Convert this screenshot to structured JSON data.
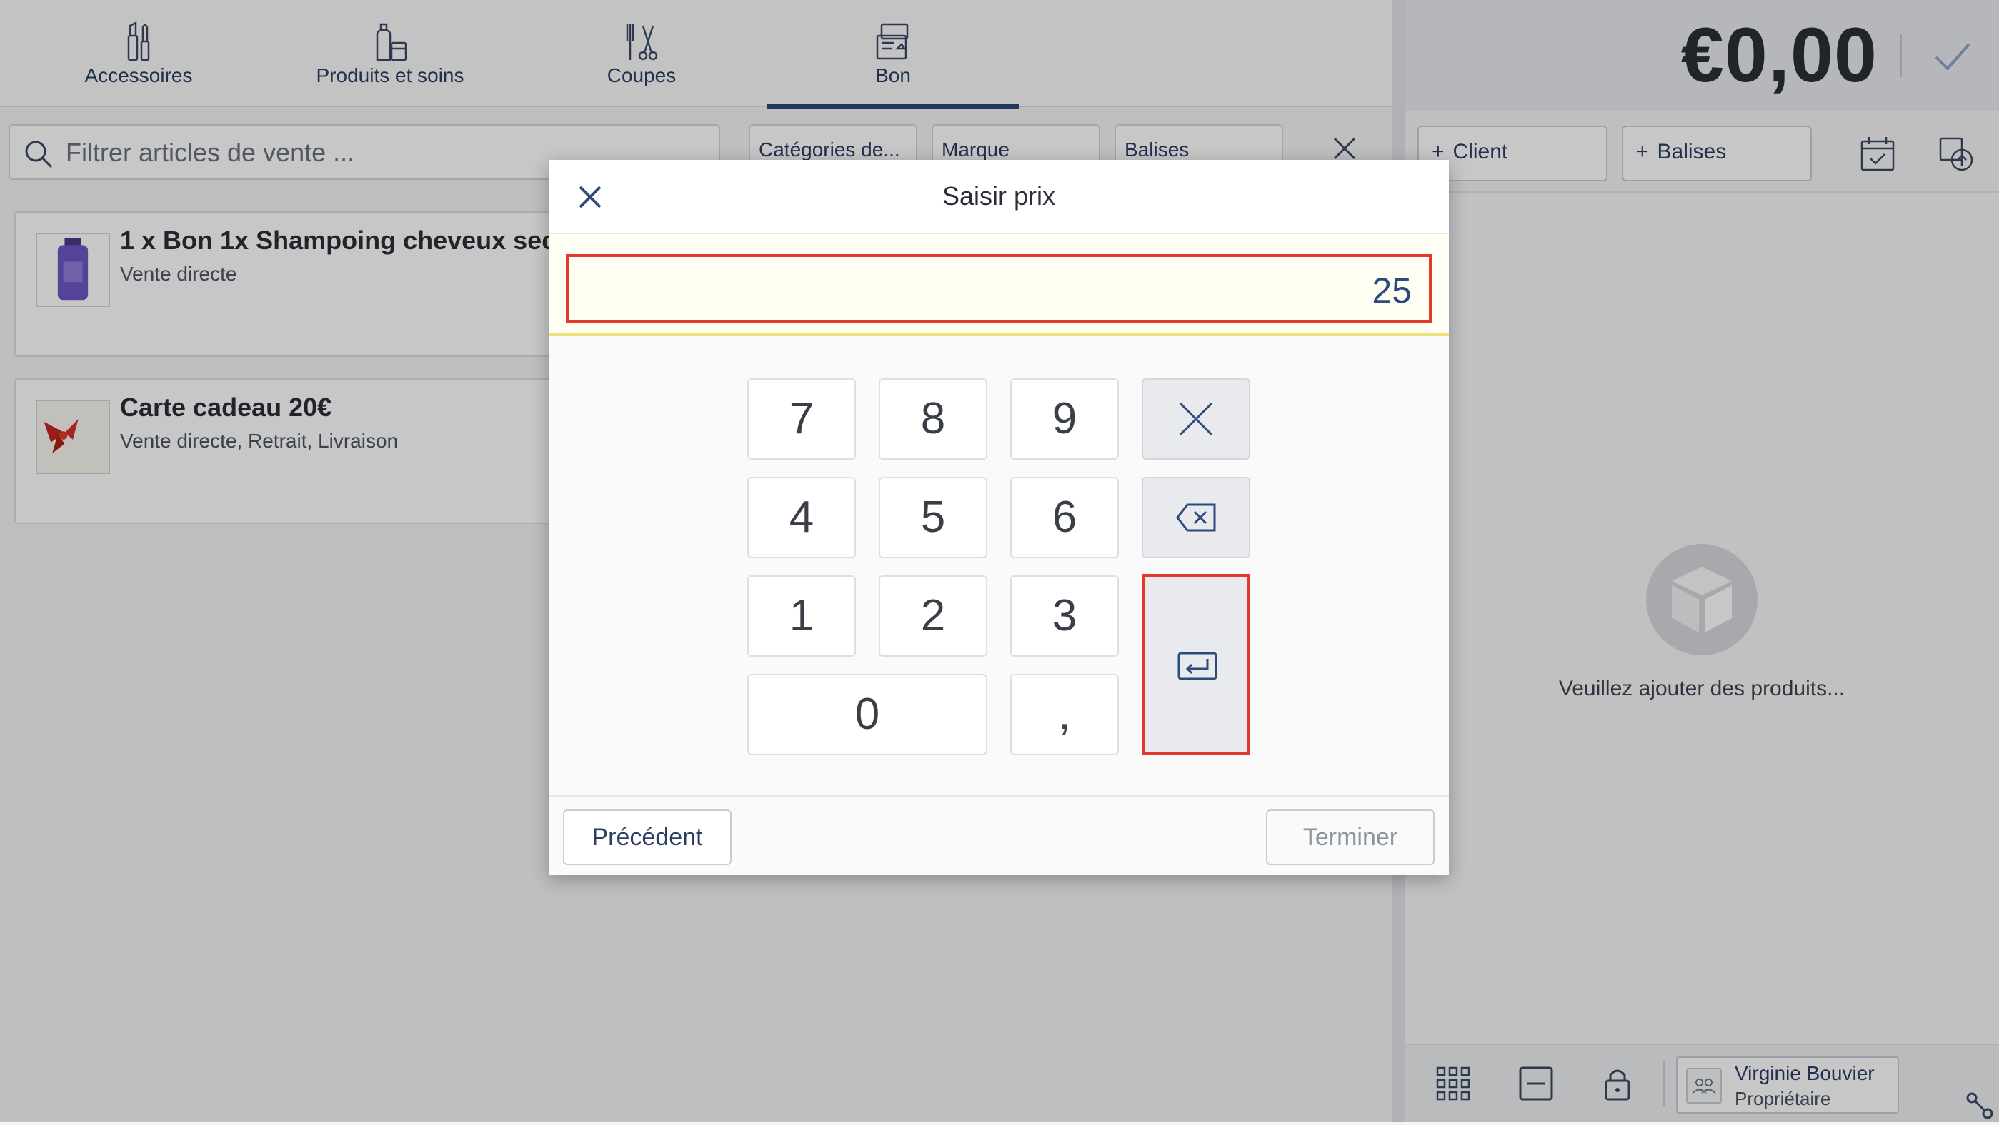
{
  "categories": [
    {
      "label": "Accessoires",
      "icon": "accessories-icon"
    },
    {
      "label": "Produits et soins",
      "icon": "products-icon"
    },
    {
      "label": "Coupes",
      "icon": "scissors-icon"
    },
    {
      "label": "Bon",
      "icon": "voucher-icon",
      "active": true
    }
  ],
  "search": {
    "placeholder": "Filtrer articles de vente ..."
  },
  "filters": {
    "categories": "Catégories de...",
    "brand": "Marque",
    "tags": "Balises"
  },
  "products": [
    {
      "name": "1 x Bon 1x Shampoing cheveux sec",
      "sub": "Vente directe",
      "thumb": "shampoo-bottle-image"
    },
    {
      "name": "Carte cadeau 20€",
      "sub": "Vente directe, Retrait, Livraison",
      "thumb": "gift-card-image"
    }
  ],
  "cart": {
    "total": "€0,00",
    "client_label": "Client",
    "tags_label": "Balises",
    "empty_text": "Veuillez ajouter des produits..."
  },
  "user": {
    "name": "Virginie Bouvier",
    "role": "Propriétaire"
  },
  "modal": {
    "title": "Saisir prix",
    "value": "25",
    "keys": {
      "k7": "7",
      "k8": "8",
      "k9": "9",
      "k4": "4",
      "k5": "5",
      "k6": "6",
      "k1": "1",
      "k2": "2",
      "k3": "3",
      "k0": "0",
      "kcomma": ","
    },
    "prev_label": "Précédent",
    "finish_label": "Terminer"
  },
  "colors": {
    "accent": "#2c4a7a",
    "highlight": "#e23b2e",
    "price_bg": "#fffef3"
  }
}
